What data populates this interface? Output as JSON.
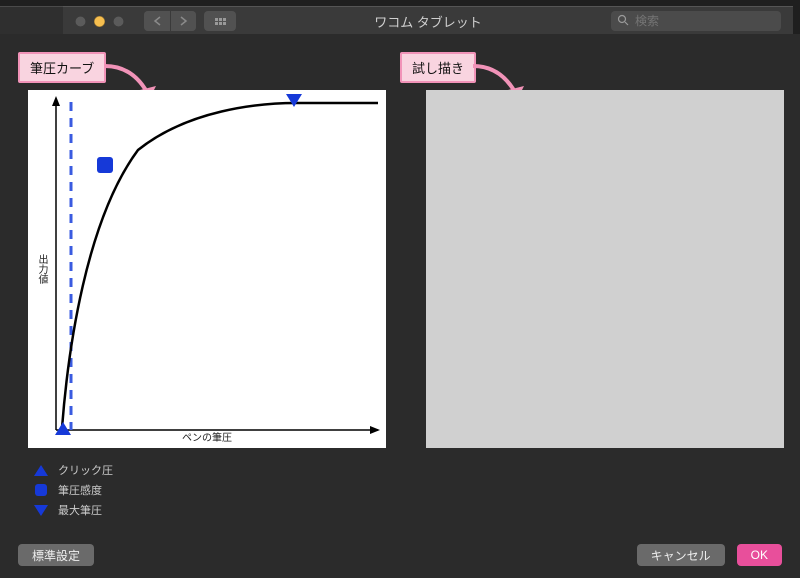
{
  "window": {
    "title": "ワコム タブレット",
    "search_placeholder": "検索"
  },
  "tags": {
    "curve": "筆圧カーブ",
    "test": "試し描き"
  },
  "chart_data": {
    "type": "line",
    "xlabel": "ペンの筆圧",
    "ylabel": "出力値",
    "xlim": [
      0,
      100
    ],
    "ylim": [
      0,
      100
    ],
    "series": [
      {
        "name": "curve",
        "x": [
          2,
          5,
          8,
          12,
          20,
          35,
          55,
          75,
          100
        ],
        "y": [
          0,
          30,
          55,
          70,
          82,
          90,
          95,
          97,
          97
        ]
      }
    ],
    "threshold_x": 5,
    "handles": {
      "click_pressure": {
        "marker": "triangle-up",
        "x": 2,
        "y": 0
      },
      "sensitivity": {
        "marker": "square",
        "x": 13,
        "y": 79
      },
      "max_pressure": {
        "marker": "triangle-down",
        "x": 75,
        "y": 100
      }
    }
  },
  "legend": {
    "click": "クリック圧",
    "sensitivity": "筆圧感度",
    "max": "最大筆圧"
  },
  "buttons": {
    "default": "標準設定",
    "cancel": "キャンセル",
    "ok": "OK"
  },
  "colors": {
    "accent_pink": "#e84f9b",
    "tag_border": "#f193b8",
    "tag_fill": "#f9d4e0",
    "control_blue": "#1639d8"
  }
}
